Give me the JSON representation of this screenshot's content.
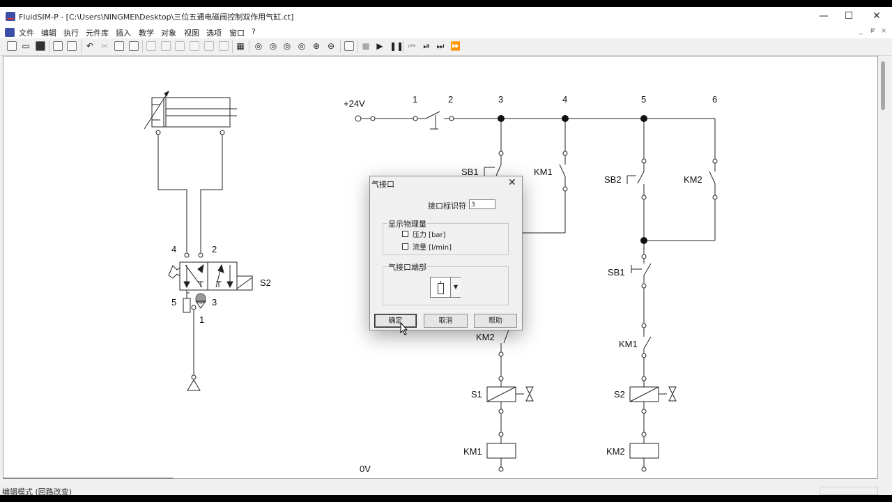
{
  "window": {
    "title": "FluidSIM-P - [C:\\Users\\NINGMEI\\Desktop\\三位五通电磁阀控制双作用气缸.ct]",
    "minimize_glyph": "—",
    "maximize_glyph": "☐",
    "close_glyph": "✕"
  },
  "menu": {
    "items": [
      "文件",
      "编辑",
      "执行",
      "元件库",
      "插入",
      "教学",
      "对象",
      "视图",
      "选项",
      "窗口",
      "?"
    ],
    "mdi_controls": [
      "_",
      "₽",
      "×"
    ]
  },
  "toolbar": {
    "icons": [
      "new-icon",
      "open-icon",
      "save-icon",
      "print-preview-icon",
      "print-icon",
      "undo-icon",
      "cut-icon",
      "copy-icon",
      "paste-icon",
      "align-left-icon",
      "align-center-icon",
      "align-right-icon",
      "align-top-icon",
      "align-middle-icon",
      "align-bottom-icon",
      "grid-icon",
      "zoom-fit-icon",
      "zoom-window-icon",
      "zoom-prev-icon",
      "zoom-all-icon",
      "zoom-in-icon",
      "zoom-out-icon",
      "check-icon",
      "stop-icon",
      "play-icon",
      "pause-icon",
      "rewind-icon",
      "step-icon",
      "forward-icon",
      "fast-forward-icon"
    ]
  },
  "pneumatic": {
    "port_4": "4",
    "port_2": "2",
    "port_5": "5",
    "port_3": "3",
    "port_1": "1",
    "solenoid": "S2"
  },
  "electrical": {
    "supply": "+24V",
    "ground": "0V",
    "nodes": [
      "1",
      "2",
      "3",
      "4",
      "5",
      "6"
    ],
    "labels": {
      "sb1_upper": "SB1",
      "km1_upper": "KM1",
      "sb2": "SB2",
      "km2_upper": "KM2",
      "sb1_lower": "SB1",
      "km2_lower": "KM2",
      "km1_lower": "KM1",
      "s1": "S1",
      "s2": "S2",
      "km1_coil": "KM1",
      "km2_coil": "KM2"
    }
  },
  "dialog": {
    "title": "气接口",
    "close_glyph": "✕",
    "identifier_label": "接口标识符",
    "identifier_value": "3",
    "group_physical": "显示物理量",
    "pressure_label": "压力 [bar]",
    "flow_label": "流量 [l/min]",
    "pressure_checked": false,
    "flow_checked": false,
    "group_terminal": "气接口端部",
    "dropdown_arrow": "▼",
    "ok_label": "确定",
    "cancel_label": "取消",
    "help_label": "帮助"
  },
  "status": {
    "mode_text": "编辑模式 (回路改变)"
  }
}
